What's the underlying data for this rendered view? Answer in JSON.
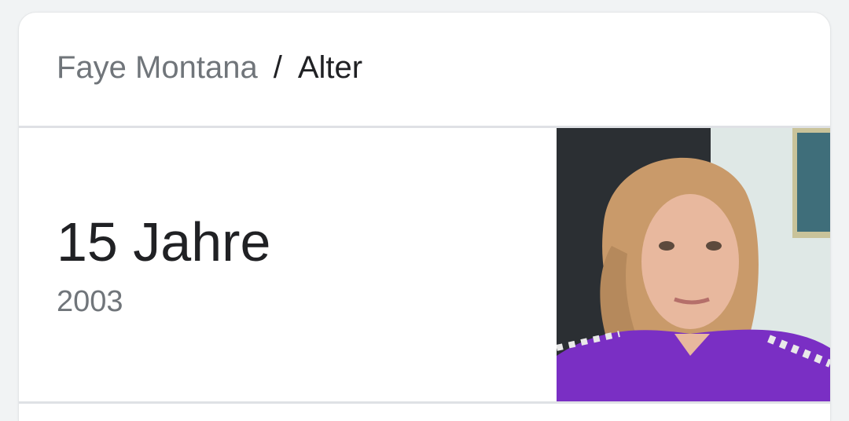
{
  "breadcrumb": {
    "parent": "Faye Montana",
    "separator": "/",
    "current": "Alter"
  },
  "answer": {
    "value": "15 Jahre",
    "sub": "2003"
  },
  "photo": {
    "subject": "portrait-photo",
    "colors": {
      "background": "#2b2f33",
      "wall": "#dfe8e6",
      "skin": "#e8b89e",
      "hair": "#c99a6a",
      "shirt": "#7a2fc4"
    }
  }
}
